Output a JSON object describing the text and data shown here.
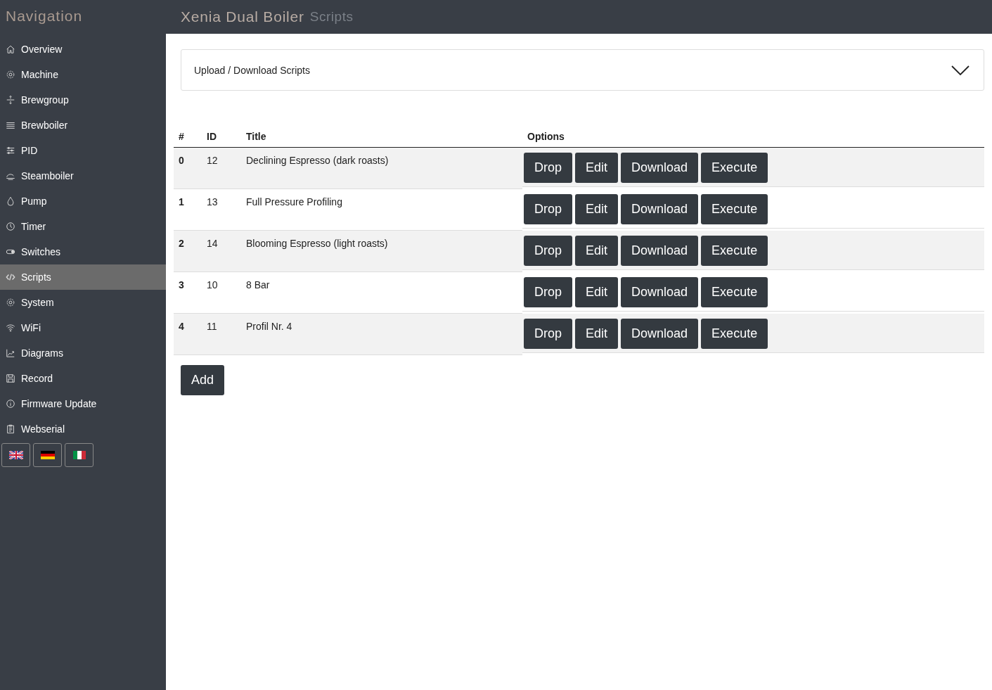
{
  "sidebar": {
    "title": "Navigation",
    "items": [
      {
        "label": "Overview",
        "selected": false
      },
      {
        "label": "Machine",
        "selected": false
      },
      {
        "label": "Brewgroup",
        "selected": false
      },
      {
        "label": "Brewboiler",
        "selected": false
      },
      {
        "label": "PID",
        "selected": false
      },
      {
        "label": "Steamboiler",
        "selected": false
      },
      {
        "label": "Pump",
        "selected": false
      },
      {
        "label": "Timer",
        "selected": false
      },
      {
        "label": "Switches",
        "selected": false
      },
      {
        "label": "Scripts",
        "selected": true
      },
      {
        "label": "System",
        "selected": false
      },
      {
        "label": "WiFi",
        "selected": false
      },
      {
        "label": "Diagrams",
        "selected": false
      },
      {
        "label": "Record",
        "selected": false
      },
      {
        "label": "Firmware Update",
        "selected": false
      },
      {
        "label": "Webserial",
        "selected": false
      }
    ]
  },
  "header": {
    "title": "Xenia Dual Boiler",
    "subtitle": "Scripts"
  },
  "accordion": {
    "label": "Upload / Download Scripts",
    "expanded": false
  },
  "table": {
    "columns": [
      "#",
      "ID",
      "Title",
      "Options"
    ],
    "rows": [
      {
        "index": "0",
        "id": "12",
        "title": "Declining Espresso (dark roasts)",
        "actions": [
          "Drop",
          "Edit",
          "Download",
          "Execute"
        ]
      },
      {
        "index": "1",
        "id": "13",
        "title": "Full Pressure Profiling",
        "actions": [
          "Drop",
          "Edit",
          "Download",
          "Execute"
        ]
      },
      {
        "index": "2",
        "id": "14",
        "title": "Blooming Espresso (light roasts)",
        "actions": [
          "Drop",
          "Edit",
          "Download",
          "Execute"
        ]
      },
      {
        "index": "3",
        "id": "10",
        "title": "8 Bar",
        "actions": [
          "Drop",
          "Edit",
          "Download",
          "Execute"
        ]
      },
      {
        "index": "4",
        "id": "11",
        "title": "Profil Nr. 4",
        "actions": [
          "Drop",
          "Edit",
          "Download",
          "Execute"
        ]
      }
    ]
  },
  "add_button": "Add"
}
